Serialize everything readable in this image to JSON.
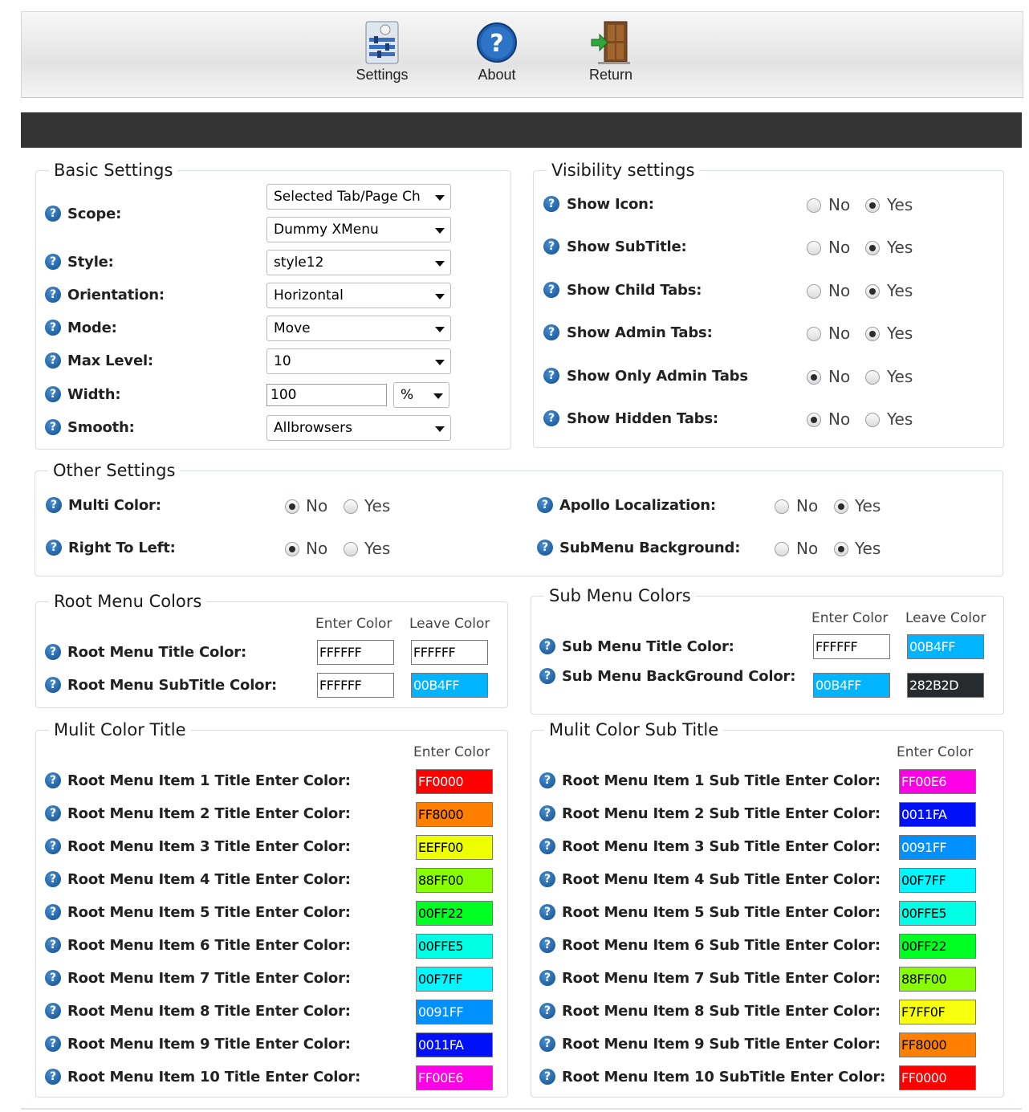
{
  "toolbar": {
    "settings_label": "Settings",
    "about_label": "About",
    "return_label": "Return"
  },
  "basic": {
    "legend": "Basic Settings",
    "scope_label": "Scope:",
    "scope_value1": "Selected Tab/Page Ch",
    "scope_value2": "Dummy XMenu",
    "style_label": "Style:",
    "style_value": "style12",
    "orientation_label": "Orientation:",
    "orientation_value": "Horizontal",
    "mode_label": "Mode:",
    "mode_value": "Move",
    "maxlevel_label": "Max Level:",
    "maxlevel_value": "10",
    "width_label": "Width:",
    "width_value": "100",
    "width_unit": "%",
    "smooth_label": "Smooth:",
    "smooth_value": "Allbrowsers"
  },
  "visibility": {
    "legend": "Visibility settings",
    "no": "No",
    "yes": "Yes",
    "items": [
      {
        "label": "Show Icon:",
        "selected": "Yes"
      },
      {
        "label": "Show SubTitle:",
        "selected": "Yes"
      },
      {
        "label": "Show Child Tabs:",
        "selected": "Yes"
      },
      {
        "label": "Show Admin Tabs:",
        "selected": "Yes"
      },
      {
        "label": "Show Only Admin Tabs",
        "selected": "No"
      },
      {
        "label": "Show Hidden Tabs:",
        "selected": "No"
      }
    ]
  },
  "other": {
    "legend": "Other Settings",
    "no": "No",
    "yes": "Yes",
    "multicolor_label": "Multi Color:",
    "multicolor_selected": "No",
    "rtl_label": "Right To Left:",
    "rtl_selected": "No",
    "apollo_label": "Apollo Localization:",
    "apollo_selected": "Yes",
    "submenubg_label": "SubMenu Background:",
    "submenubg_selected": "Yes"
  },
  "root_colors": {
    "legend": "Root Menu Colors",
    "enter_hdr": "Enter Color",
    "leave_hdr": "Leave Color",
    "title_label": "Root Menu Title Color:",
    "title_enter": "FFFFFF",
    "title_leave": "FFFFFF",
    "subtitle_label": "Root Menu SubTitle Color:",
    "subtitle_enter": "FFFFFF",
    "subtitle_leave": "00B4FF"
  },
  "sub_colors": {
    "legend": "Sub Menu Colors",
    "enter_hdr": "Enter Color",
    "leave_hdr": "Leave Color",
    "title_label": "Sub Menu Title Color:",
    "title_enter": "FFFFFF",
    "title_leave": "00B4FF",
    "bg_label": "Sub Menu BackGround Color:",
    "bg_enter": "00B4FF",
    "bg_leave": "282B2D"
  },
  "multi_title": {
    "legend": "Mulit Color Title",
    "enter_hdr": "Enter Color",
    "items": [
      {
        "label": "Root Menu Item 1 Title Enter Color:",
        "value": "FF0000"
      },
      {
        "label": "Root Menu Item 2 Title Enter Color:",
        "value": "FF8000"
      },
      {
        "label": "Root Menu Item 3 Title Enter Color:",
        "value": "EEFF00"
      },
      {
        "label": "Root Menu Item 4 Title Enter Color:",
        "value": "88FF00"
      },
      {
        "label": "Root Menu Item 5 Title Enter Color:",
        "value": "00FF22"
      },
      {
        "label": "Root Menu Item 6 Title Enter Color:",
        "value": "00FFE5"
      },
      {
        "label": "Root Menu Item 7 Title Enter Color:",
        "value": "00F7FF"
      },
      {
        "label": "Root Menu Item 8 Title Enter Color:",
        "value": "0091FF"
      },
      {
        "label": "Root Menu Item 9 Title Enter Color:",
        "value": "0011FA"
      },
      {
        "label": "Root Menu Item 10 Title Enter Color:",
        "value": "FF00E6"
      }
    ]
  },
  "multi_subtitle": {
    "legend": "Mulit Color Sub Title",
    "enter_hdr": "Enter Color",
    "items": [
      {
        "label": "Root Menu Item 1 Sub Title Enter Color:",
        "value": "FF00E6"
      },
      {
        "label": "Root Menu Item 2 Sub Title Enter Color:",
        "value": "0011FA"
      },
      {
        "label": "Root Menu Item 3 Sub Title Enter Color:",
        "value": "0091FF"
      },
      {
        "label": "Root Menu Item 4 Sub Title Enter Color:",
        "value": "00F7FF"
      },
      {
        "label": "Root Menu Item 5 Sub Title Enter Color:",
        "value": "00FFE5"
      },
      {
        "label": "Root Menu Item 6 Sub Title Enter Color:",
        "value": "00FF22"
      },
      {
        "label": "Root Menu Item 7 Sub Title Enter Color:",
        "value": "88FF00"
      },
      {
        "label": "Root Menu Item 8 Sub Title Enter Color:",
        "value": "F7FF0F"
      },
      {
        "label": "Root Menu Item 9 Sub Title Enter Color:",
        "value": "FF8000"
      },
      {
        "label": "Root Menu Item 10 SubTitle Enter Color:",
        "value": "FF0000"
      }
    ]
  }
}
